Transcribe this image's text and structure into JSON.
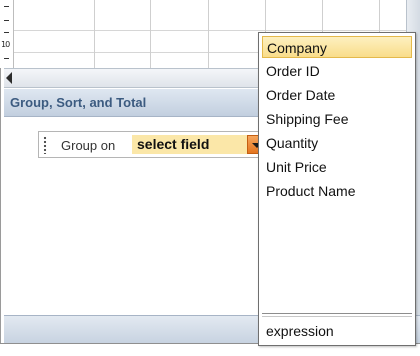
{
  "ruler": {
    "number": "10"
  },
  "pane": {
    "title": "Group, Sort, and Total",
    "group_on_label": "Group on",
    "select_field_value": "select field"
  },
  "field_list": {
    "items": [
      {
        "label": "Company",
        "selected": true
      },
      {
        "label": "Order ID",
        "selected": false
      },
      {
        "label": "Order Date",
        "selected": false
      },
      {
        "label": "Shipping Fee",
        "selected": false
      },
      {
        "label": "Quantity",
        "selected": false
      },
      {
        "label": "Unit Price",
        "selected": false
      },
      {
        "label": "Product Name",
        "selected": false
      }
    ],
    "expression_label": "expression"
  },
  "colors": {
    "header_text": "#3c5b80",
    "select_field_bg": "#fbe7a8",
    "dropdown_button": "#e4751f",
    "selected_item_bg": "#f9dd8a"
  }
}
